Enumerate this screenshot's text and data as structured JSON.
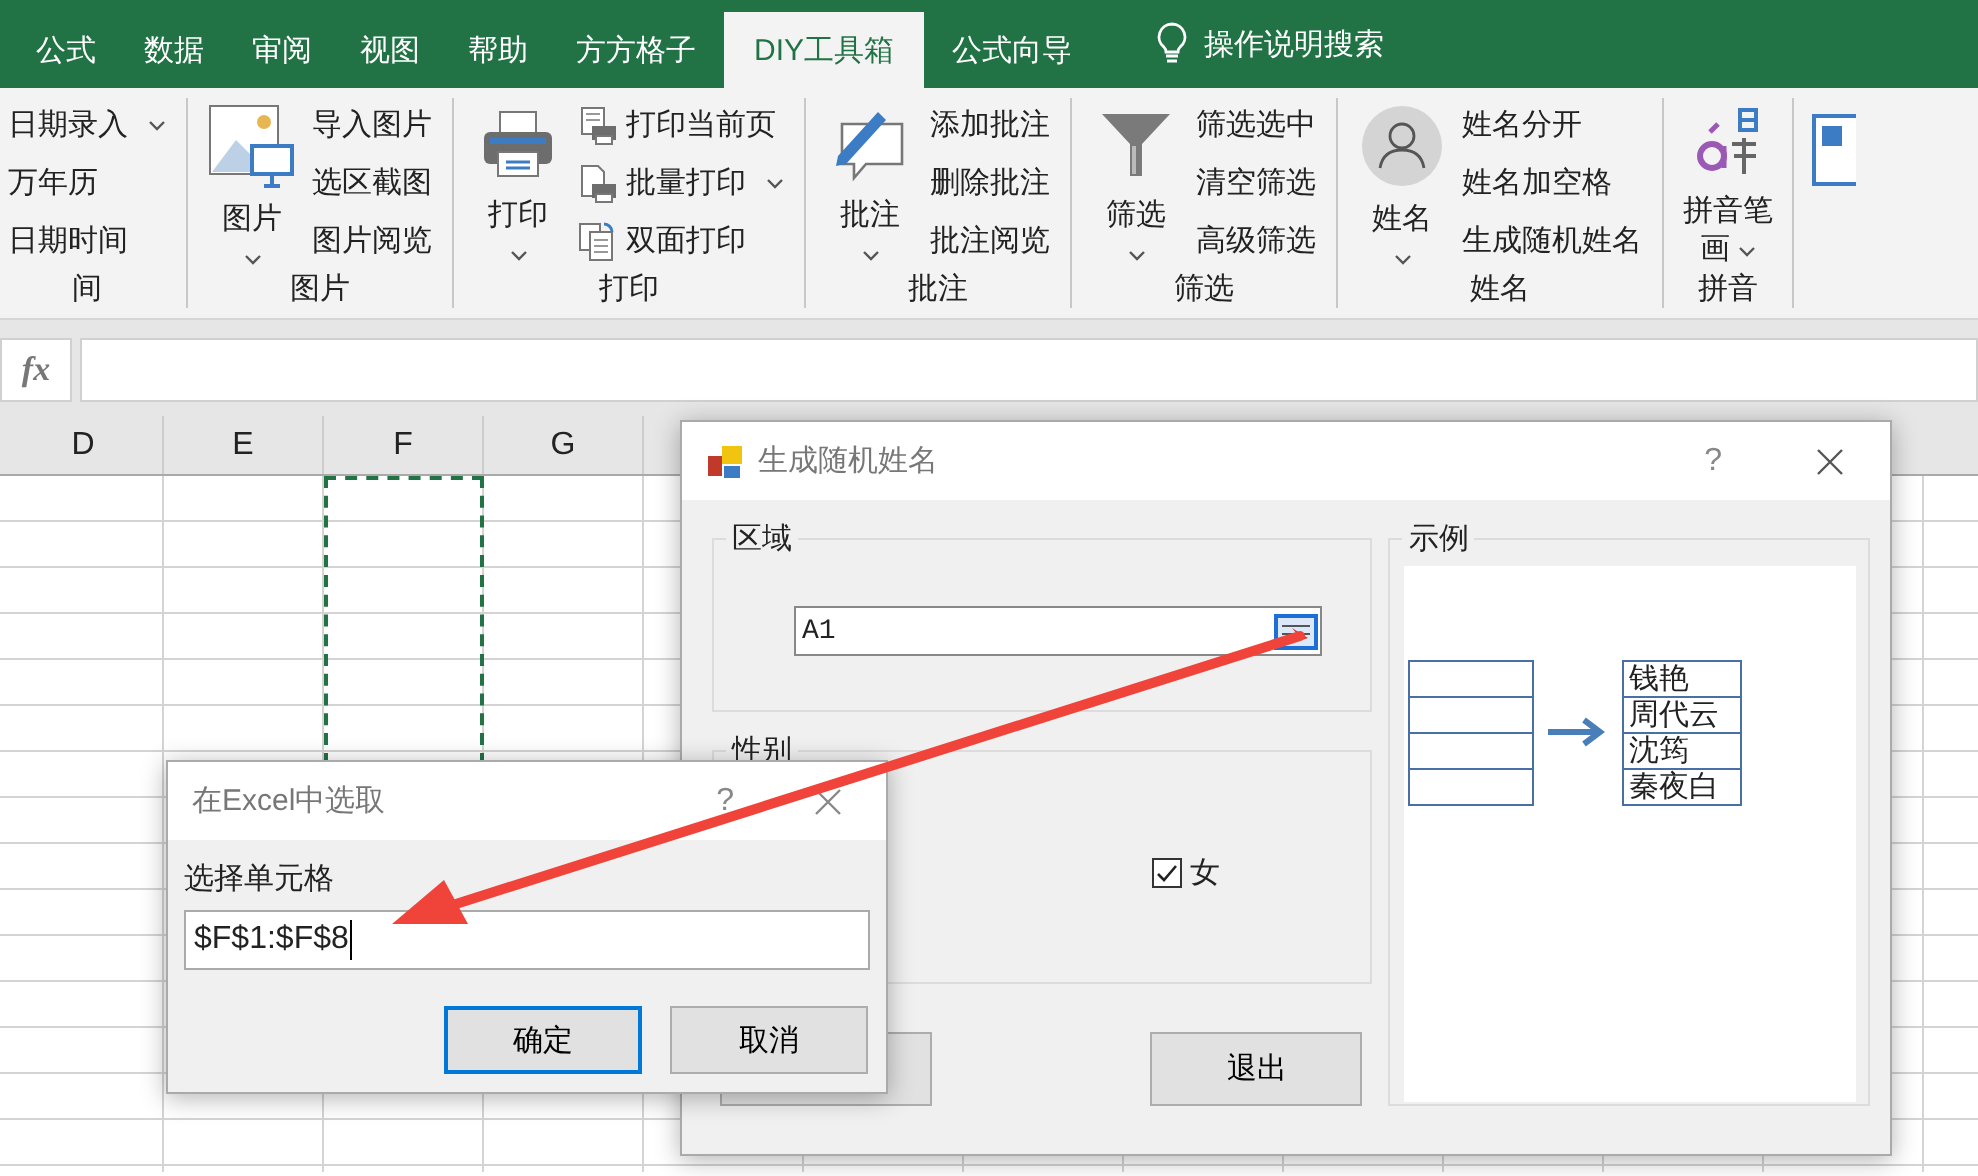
{
  "ribbon_tabs": [
    {
      "label": "公式",
      "selected": false
    },
    {
      "label": "数据",
      "selected": false
    },
    {
      "label": "审阅",
      "selected": false
    },
    {
      "label": "视图",
      "selected": false
    },
    {
      "label": "帮助",
      "selected": false
    },
    {
      "label": "方方格子",
      "selected": false
    },
    {
      "label": "DIY工具箱",
      "selected": true
    },
    {
      "label": "公式向导",
      "selected": false
    }
  ],
  "tell_me": {
    "label": "操作说明搜索"
  },
  "ribbon_groups": [
    {
      "label": "间",
      "items": [
        {
          "label": "日期录入",
          "kind": "text",
          "dropdown": true
        },
        {
          "label": "万年历",
          "kind": "text",
          "dropdown": false
        },
        {
          "label": "日期时间",
          "kind": "text",
          "dropdown": false
        }
      ]
    },
    {
      "label": "图片",
      "big": {
        "label": "图片",
        "kind": "picture"
      },
      "items": [
        {
          "label": "导入图片",
          "kind": "text",
          "dropdown": false
        },
        {
          "label": "选区截图",
          "kind": "text",
          "dropdown": false
        },
        {
          "label": "图片阅览",
          "kind": "text",
          "dropdown": false
        }
      ]
    },
    {
      "label": "打印",
      "big": {
        "label": "打印",
        "kind": "printer"
      },
      "items": [
        {
          "label": "打印当前页",
          "kind": "page",
          "dropdown": false
        },
        {
          "label": "批量打印",
          "kind": "batch",
          "dropdown": true
        },
        {
          "label": "双面打印",
          "kind": "duplex",
          "dropdown": false
        }
      ]
    },
    {
      "label": "批注",
      "big": {
        "label": "批注",
        "kind": "comment"
      },
      "items": [
        {
          "label": "添加批注",
          "kind": "text",
          "dropdown": false
        },
        {
          "label": "删除批注",
          "kind": "text",
          "dropdown": false
        },
        {
          "label": "批注阅览",
          "kind": "text",
          "dropdown": false
        }
      ]
    },
    {
      "label": "筛选",
      "big": {
        "label": "筛选",
        "kind": "filter"
      },
      "items": [
        {
          "label": "筛选选中",
          "kind": "text",
          "dropdown": false
        },
        {
          "label": "清空筛选",
          "kind": "text",
          "dropdown": false
        },
        {
          "label": "高级筛选",
          "kind": "text",
          "dropdown": false
        }
      ]
    },
    {
      "label": "姓名",
      "big": {
        "label": "姓名",
        "kind": "person"
      },
      "items": [
        {
          "label": "姓名分开",
          "kind": "text",
          "dropdown": false
        },
        {
          "label": "姓名加空格",
          "kind": "text",
          "dropdown": false
        },
        {
          "label": "生成随机姓名",
          "kind": "text",
          "dropdown": false
        }
      ]
    },
    {
      "label": "拼音",
      "big": {
        "label": "拼音笔画",
        "kind": "pinyin"
      }
    }
  ],
  "formula_bar": {
    "fx": "fx"
  },
  "sheet": {
    "columns": [
      {
        "label": "D",
        "marquee": false
      },
      {
        "label": "E",
        "marquee": false
      },
      {
        "label": "F",
        "marquee": true
      },
      {
        "label": "G",
        "marquee": false
      }
    ]
  },
  "random_name_dialog": {
    "title": "生成随机姓名",
    "help": "?",
    "area": {
      "label": "区域",
      "value": "A1"
    },
    "gender": {
      "label": "性别",
      "options": [
        {
          "label": "女",
          "checked": true
        }
      ]
    },
    "exit_button": "退出",
    "example": {
      "label": "示例",
      "names": [
        "钱艳",
        "周代云",
        "沈筠",
        "秦夜白"
      ]
    }
  },
  "pick_dialog": {
    "title": "在Excel中选取",
    "help": "?",
    "label": "选择单元格",
    "value": "$F$1:$F$8",
    "buttons": [
      {
        "label": "确定",
        "default": true
      },
      {
        "label": "取消",
        "default": false
      }
    ]
  }
}
